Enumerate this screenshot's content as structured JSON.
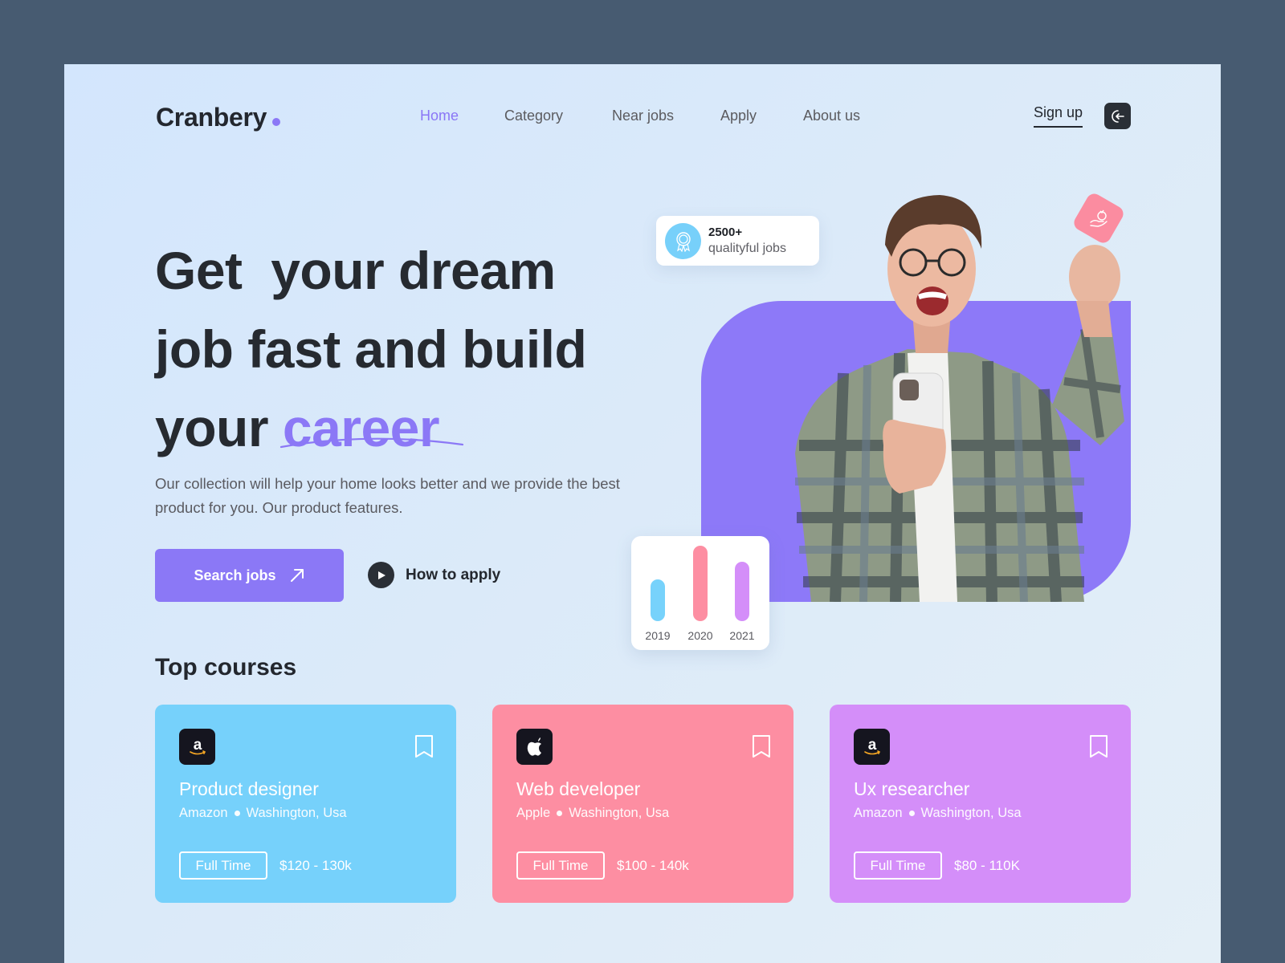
{
  "brand": {
    "name": "Cranbery",
    "accent": "#8b78f6"
  },
  "nav": {
    "items": [
      {
        "label": "Home",
        "active": true
      },
      {
        "label": "Category",
        "active": false
      },
      {
        "label": "Near jobs",
        "active": false
      },
      {
        "label": "Apply",
        "active": false
      },
      {
        "label": "About us",
        "active": false
      }
    ],
    "signup_label": "Sign up",
    "login_icon": "login-arrow-icon"
  },
  "hero": {
    "line1": "Get  your dream",
    "line2": "job fast and build",
    "line3_plain": "your ",
    "line3_highlight": "career",
    "description": "Our collection will help your home looks better and we provide the best product for you. Our  product features.",
    "primary_button": "Search jobs",
    "secondary_button": "How to apply"
  },
  "stat": {
    "icon": "award-badge-icon",
    "value": "2500+",
    "label": "qualityful jobs"
  },
  "floating_tile_icon": "money-bag-hand-icon",
  "chart_data": {
    "type": "bar",
    "categories": [
      "2019",
      "2020",
      "2021"
    ],
    "values": [
      52,
      94,
      74
    ],
    "colors": [
      "#77d2fb",
      "#fd8ea2",
      "#d48ef9"
    ],
    "title": "",
    "xlabel": "",
    "ylabel": "",
    "ylim": [
      0,
      100
    ]
  },
  "courses": {
    "title": "Top courses",
    "items": [
      {
        "title": "Product designer",
        "company": "Amazon",
        "location": "Washington, Usa",
        "type": "Full Time",
        "salary": "$120 - 130k",
        "logo": "amazon-logo-icon",
        "color": "#76d1fb"
      },
      {
        "title": "Web developer",
        "company": "Apple",
        "location": "Washington, Usa",
        "type": "Full Time",
        "salary": "$100 - 140k",
        "logo": "apple-logo-icon",
        "color": "#fd8ea2"
      },
      {
        "title": "Ux researcher",
        "company": "Amazon",
        "location": "Washington, Usa",
        "type": "Full Time",
        "salary": "$80 - 110K",
        "logo": "amazon-logo-icon",
        "color": "#d48ef9"
      }
    ]
  }
}
